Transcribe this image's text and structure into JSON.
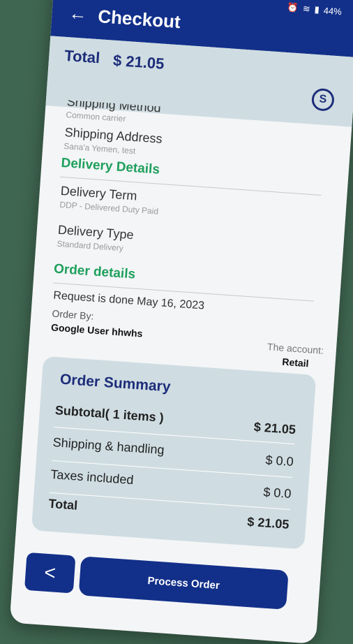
{
  "status_bar": {
    "battery": "44%"
  },
  "header": {
    "title": "Checkout"
  },
  "total_bar": {
    "label": "Total",
    "value": "$ 21.05"
  },
  "shipping": {
    "method_label": "Shipping Method",
    "method_value": "Common carrier",
    "address_label": "Shipping Address",
    "address_value": "Sana'a Yemen, test"
  },
  "delivery": {
    "section_title": "Delivery Details",
    "term_label": "Delivery Term",
    "term_value": "DDP - Delivered Duty Paid",
    "type_label": "Delivery Type",
    "type_value": "Standard Delivery"
  },
  "order_details": {
    "section_title": "Order details",
    "request": "Request is done May 16, 2023",
    "order_by_label": "Order By:",
    "order_by_value": "Google User hhwhs",
    "account_label": "The account:",
    "account_value": "Retail"
  },
  "summary": {
    "title": "Order Summary",
    "rows": [
      {
        "label": "Subtotal( 1 items )",
        "value": "$ 21.05"
      },
      {
        "label": "Shipping & handling",
        "value": "$ 0.0"
      },
      {
        "label": "Taxes included",
        "value": "$ 0.0"
      },
      {
        "label": "Total",
        "value": "$ 21.05"
      }
    ]
  },
  "actions": {
    "process_label": "Process Order"
  },
  "colors": {
    "primary": "#123089",
    "accent_green": "#1ea05c",
    "card_bg": "#cfdde2"
  }
}
